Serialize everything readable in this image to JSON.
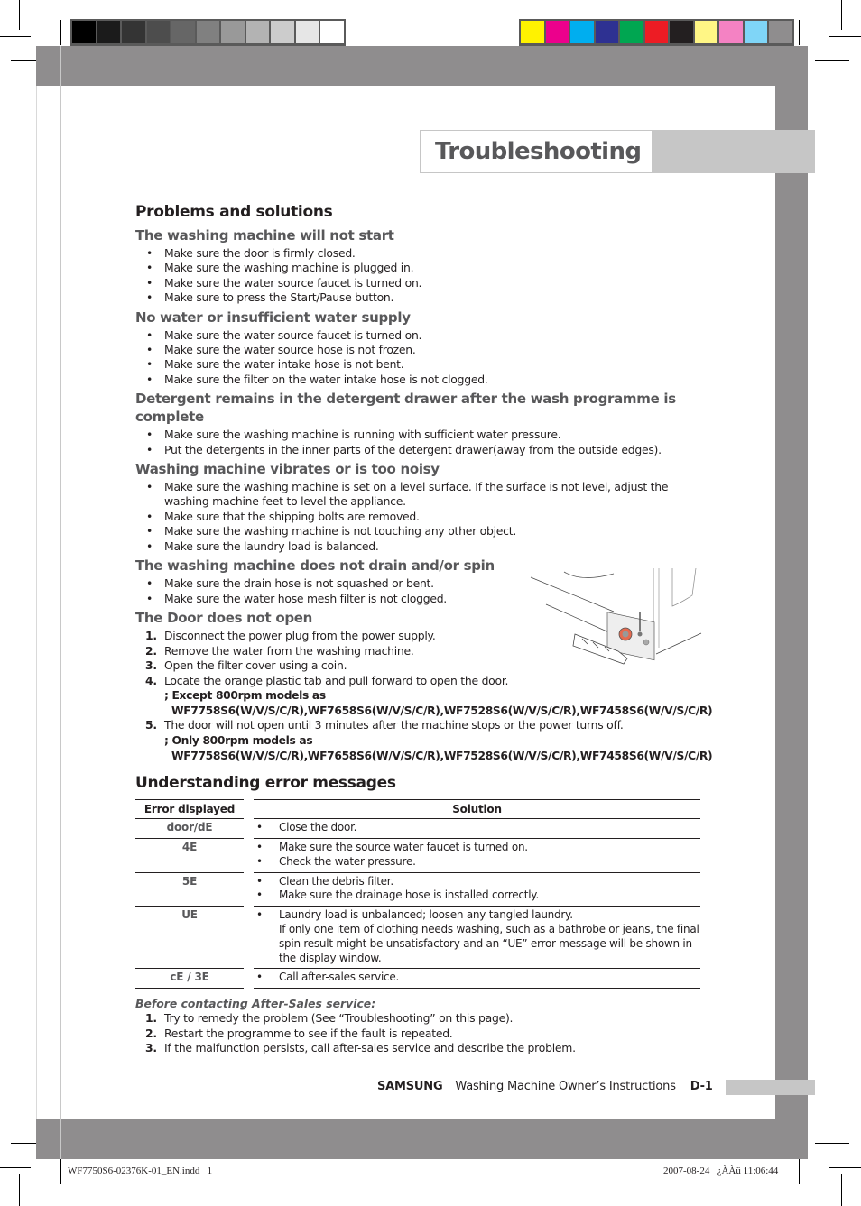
{
  "print_marks": {
    "gray_swatches": [
      "#000000",
      "#1b1b1b",
      "#343434",
      "#4d4d4d",
      "#666666",
      "#808080",
      "#999999",
      "#b3b3b3",
      "#cccccc",
      "#e6e6e6",
      "#ffffff"
    ],
    "color_swatches": [
      "#fff200",
      "#ec008c",
      "#00aeef",
      "#2e3192",
      "#00a651",
      "#ed1c24",
      "#231f20",
      "#fff685",
      "#f482c3",
      "#7fd5f7",
      "#8f8d8e"
    ],
    "slug_left": "WF7750S6-02376K-01_EN.indd   1",
    "slug_right": "2007-08-24   ¿ÀÀü 11:06:44"
  },
  "header": {
    "title": "Troubleshooting"
  },
  "problems": {
    "heading": "Problems and solutions",
    "sections": [
      {
        "title": "The washing machine will not start",
        "items": [
          "Make sure the door is firmly closed.",
          "Make sure the washing machine is plugged in.",
          "Make sure the water source faucet is turned on.",
          "Make sure to press the Start/Pause button."
        ]
      },
      {
        "title": "No water or insufficient water supply",
        "items": [
          "Make sure the water source faucet is turned on.",
          "Make sure the water source hose is not frozen.",
          "Make sure the water intake hose is not bent.",
          "Make sure the filter on the water intake hose is not clogged."
        ]
      },
      {
        "title": "Detergent remains in the detergent drawer after the wash programme is complete",
        "items": [
          "Make sure the washing machine is running with sufficient water pressure.",
          "Put the detergents in the inner parts of the detergent drawer(away from the outside edges)."
        ]
      },
      {
        "title": "Washing machine vibrates or is too noisy",
        "items": [
          "Make sure the washing machine is set on a level surface. If the surface is not level, adjust the washing machine feet to level the appliance.",
          "Make sure that the shipping bolts are removed.",
          "Make sure the washing machine is not touching any other object.",
          "Make sure the laundry load is balanced."
        ]
      },
      {
        "title": "The washing machine does not drain and/or spin",
        "items": [
          "Make sure the drain hose is not squashed or bent.",
          "Make sure the water hose mesh filter is not clogged."
        ]
      }
    ],
    "door": {
      "title": "The Door does not open",
      "steps": [
        {
          "num": "1.",
          "text": "Disconnect the power plug from the power supply."
        },
        {
          "num": "2.",
          "text": "Remove the water from the washing machine."
        },
        {
          "num": "3.",
          "text": "Open the filter cover using a coin."
        },
        {
          "num": "4.",
          "text": "Locate the orange plastic tab and pull forward to open the door.",
          "note": "; Except 800rpm models as WF7758S6(W/V/S/C/R),WF7658S6(W/V/S/C/R),WF7528S6(W/V/S/C/R),WF7458S6(W/V/S/C/R)"
        },
        {
          "num": "5.",
          "text": "The door will not open until 3 minutes after the machine stops or the power turns off.",
          "note": "; Only 800rpm models as WF7758S6(W/V/S/C/R),WF7658S6(W/V/S/C/R),WF7528S6(W/V/S/C/R),WF7458S6(W/V/S/C/R)"
        }
      ]
    }
  },
  "errors": {
    "heading": "Understanding error messages",
    "col_error": "Error displayed",
    "col_solution": "Solution",
    "rows": [
      {
        "code": "door/dE",
        "solutions": [
          "Close the door."
        ]
      },
      {
        "code": "4E",
        "solutions": [
          "Make sure the source water faucet is turned on.",
          "Check the water pressure."
        ]
      },
      {
        "code": "5E",
        "solutions": [
          "Clean the debris filter.",
          "Make sure the drainage hose is installed correctly."
        ]
      },
      {
        "code": "UE",
        "solutions": [
          "Laundry load is unbalanced; loosen any tangled laundry."
        ],
        "extra": "If only one item of clothing needs washing, such as a bathrobe or jeans, the final spin result might be unsatisfactory and an “UE” error message will be shown in the display window."
      },
      {
        "code": "cE / 3E",
        "solutions": [
          "Call after-sales service."
        ]
      }
    ]
  },
  "before_service": {
    "heading": "Before contacting After-Sales service:",
    "steps": [
      {
        "num": "1.",
        "text": " Try to remedy the problem (See “Troubleshooting” on this page)."
      },
      {
        "num": "2.",
        "text": "Restart the programme to see if the fault is repeated."
      },
      {
        "num": "3.",
        "text": "If the malfunction persists, call after-sales service and describe the problem."
      }
    ]
  },
  "footer": {
    "brand": "SAMSUNG",
    "doc_title": "Washing Machine Owner’s Instructions",
    "page": "D-1"
  }
}
